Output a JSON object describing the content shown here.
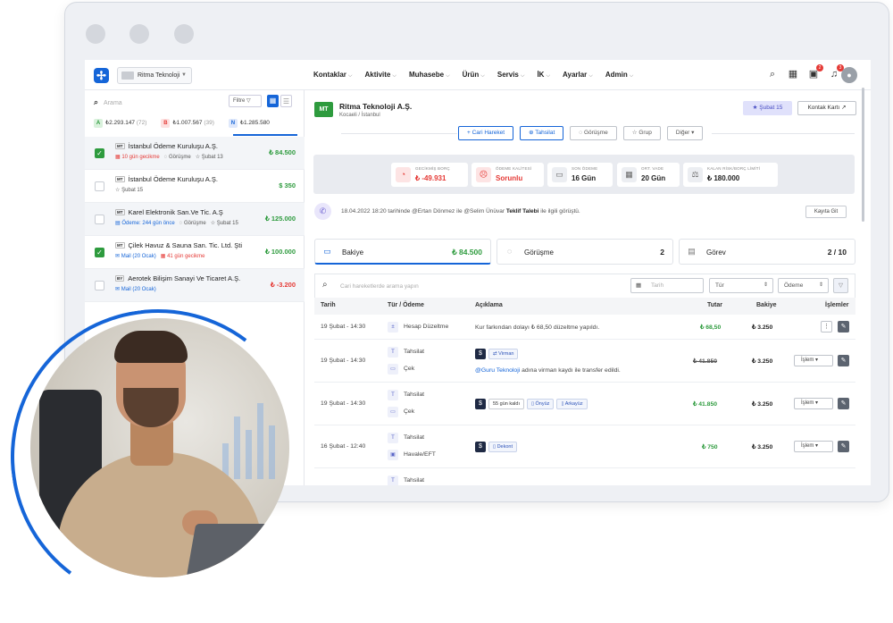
{
  "nav": {
    "company": "Ritma Teknoloji",
    "menu": [
      "Kontaklar",
      "Aktivite",
      "Muhasebe",
      "Ürün",
      "Servis",
      "İK",
      "Ayarlar",
      "Admin"
    ],
    "notif_badges": [
      "2",
      "3"
    ]
  },
  "sidebar": {
    "search_placeholder": "Arama",
    "filter_label": "Filtre",
    "totals": [
      {
        "letter": "A",
        "amount": "₺2.293.147",
        "count": "(72)"
      },
      {
        "letter": "B",
        "amount": "₺1.007.567",
        "count": "(39)"
      },
      {
        "letter": "N",
        "amount": "₺1.285.580",
        "count": ""
      }
    ],
    "items": [
      {
        "tag": "MT",
        "name": "İstanbul Ödeme Kuruluşu A.Ş.",
        "meta1": "10 gün gecikme",
        "meta2": "Görüşme",
        "meta3": "Şubat 13",
        "amount": "₺ 84.500"
      },
      {
        "tag": "MT",
        "name": "İstanbul Ödeme Kuruluşu A.Ş.",
        "meta1": "Şubat 15",
        "meta2": "",
        "meta3": "",
        "amount": "$ 350"
      },
      {
        "tag": "MT",
        "name": "Karel Elektronik San.Ve Tic. A.Ş",
        "meta1": "Ödeme: 244 gün önce",
        "meta2": "Görüşme",
        "meta3": "Şubat 15",
        "amount": "₺ 125.000"
      },
      {
        "tag": "MT",
        "name": "Çilek Havuz & Sauna San. Tic. Ltd. Şti",
        "meta1": "Mail (20 Ocak)",
        "meta2": "41 gün gecikme",
        "meta3": "",
        "amount": "₺ 100.000"
      },
      {
        "tag": "BY",
        "name": "Aerotek Bilişim Sanayi Ve Ticaret A.Ş.",
        "meta1": "Mail (20 Ocak)",
        "meta2": "",
        "meta3": "",
        "amount": "₺ -3.200"
      }
    ]
  },
  "company": {
    "initials": "MT",
    "name": "Ritma Teknoloji A.Ş.",
    "location": "Kocaeli / İstanbul",
    "date_button": "Şubat 15",
    "card_button": "Kontak Kartı",
    "actions": [
      "Cari Hareket",
      "Tahsilat",
      "Görüşme",
      "Grup",
      "Diğer"
    ]
  },
  "stats": [
    {
      "label": "GECİKMİŞ BORÇ",
      "value": "₺ -49.931"
    },
    {
      "label": "ÖDEME KALİTESİ",
      "value": "Sorunlu"
    },
    {
      "label": "SON ÖDEME",
      "value": "16 Gün"
    },
    {
      "label": "ORT. VADE",
      "value": "20 Gün"
    },
    {
      "label": "KALAN RİSK/BORÇ LİMİTİ",
      "value": "₺ 180.000"
    }
  ],
  "activity": {
    "prefix": "18.04.2022 18:20 tarihinde @Ertan Dönmez ile @Selim Ünüvar",
    "bold": "Teklif Talebi",
    "suffix": "ile ilgili görüştü.",
    "button": "Kayıta Git"
  },
  "tabs": [
    {
      "label": "Bakiye",
      "value": "₺ 84.500"
    },
    {
      "label": "Görüşme",
      "value": "2"
    },
    {
      "label": "Görev",
      "value": "2 / 10"
    }
  ],
  "table": {
    "search_placeholder": "Cari hareketlerde arama yapın",
    "date_placeholder": "Tarih",
    "type_filter": "Tür",
    "pay_filter": "Ödeme",
    "headers": [
      "Tarih",
      "Tür / Ödeme",
      "Açıklama",
      "Tutar",
      "Bakiye",
      "İşlemler"
    ],
    "rows": [
      {
        "date": "19 Şubat - 14:30",
        "type": "Hesap Düzeltme",
        "type2": "",
        "desc": "Kur farkından dolayı ₺ 68,50 düzeltme yapıldı.",
        "amount": "₺ 68,50",
        "balance": "₺ 3.250"
      },
      {
        "date": "19 Şubat - 14:30",
        "type": "Tahsilat",
        "type2": "Çek",
        "pill": "Virman",
        "desc_link": "@Guru Teknoloji",
        "desc": "adına virman kaydı ile transfer edildi.",
        "amount": "₺ 41.850",
        "balance": "₺ 3.250"
      },
      {
        "date": "19 Şubat - 14:30",
        "type": "Tahsilat",
        "type2": "Çek",
        "pills": [
          "55 gün kaldı",
          "Önyüz",
          "Arkayüz"
        ],
        "amount": "₺ 41.850",
        "balance": "₺ 3.250"
      },
      {
        "date": "16 Şubat - 12:40",
        "type": "Tahsilat",
        "type2": "Havale/EFT",
        "pill": "Dekont",
        "amount": "₺ 750",
        "balance": "₺ 3.250"
      },
      {
        "type": "Tahsilat"
      }
    ],
    "action_label": "İşlem"
  }
}
